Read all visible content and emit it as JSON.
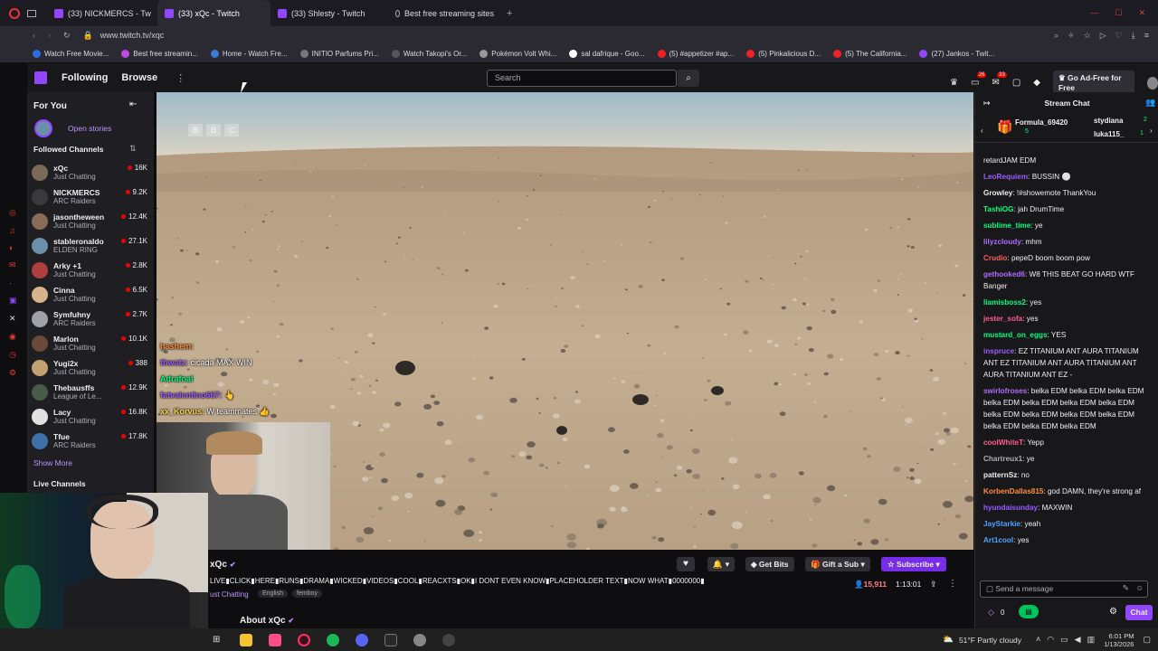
{
  "browser": {
    "tabs": [
      {
        "label": "(33) NICKMERCS - Tw"
      },
      {
        "label": "(33) xQc - Twitch"
      },
      {
        "label": "(33) Shlesty - Twitch"
      },
      {
        "label": "Best free streaming sites"
      }
    ],
    "url": "www.twitch.tv/xqc",
    "bookmarks": [
      "Watch Free Movie...",
      "Best free streamin...",
      "Home - Watch Fre...",
      "INITIO Parfums Pri...",
      "Watch Takopi's Or...",
      "Pokémon Volt Whi...",
      "sal dafrique - Goo...",
      "(5) #appetizer #ap...",
      "(5) Pinkalicious D...",
      "(5) The California...",
      "(27) Jankos - Twit..."
    ]
  },
  "nav": {
    "following": "Following",
    "browse": "Browse",
    "search_placeholder": "Search",
    "notif_badge": "26",
    "inbox_badge": "33",
    "ad_free": "Go Ad-Free for Free"
  },
  "sidebar": {
    "for_you": "For You",
    "open_stories": "Open stories",
    "followed": "Followed Channels",
    "channels": [
      {
        "name": "xQc",
        "game": "Just Chatting",
        "viewers": "16K",
        "color": "#7a6a58"
      },
      {
        "name": "NICKMERCS",
        "game": "ARC Raiders",
        "viewers": "9.2K",
        "color": "#3a3a3a"
      },
      {
        "name": "jasontheween",
        "game": "Just Chatting",
        "viewers": "12.4K",
        "color": "#8a6b55"
      },
      {
        "name": "stableronaldo",
        "game": "ELDEN RING",
        "viewers": "27.1K",
        "color": "#6b8fa8"
      },
      {
        "name": "Arky +1",
        "game": "Just Chatting",
        "viewers": "2.8K",
        "color": "#b04040"
      },
      {
        "name": "Cinna",
        "game": "Just Chatting",
        "viewers": "6.5K",
        "color": "#d6b38a"
      },
      {
        "name": "Symfuhny",
        "game": "ARC Raiders",
        "viewers": "2.7K",
        "color": "#a0a0a8"
      },
      {
        "name": "Marlon",
        "game": "Just Chatting",
        "viewers": "10.1K",
        "color": "#6a4a3a"
      },
      {
        "name": "Yugi2x",
        "game": "Just Chatting",
        "viewers": "388",
        "color": "#c2a070"
      },
      {
        "name": "Thebausffs",
        "game": "League of Le...",
        "viewers": "12.9K",
        "color": "#4a5a4a"
      },
      {
        "name": "Lacy",
        "game": "Just Chatting",
        "viewers": "16.8K",
        "color": "#e0e0e0"
      },
      {
        "name": "Tfue",
        "game": "ARC Raiders",
        "viewers": "17.8K",
        "color": "#3d6fa8"
      }
    ],
    "show_more": "Show More",
    "live_channels": "Live Channels"
  },
  "video": {
    "watermark": [
      "B",
      "B",
      "C"
    ],
    "overlay_chat": [
      {
        "user": "hashem:",
        "text": ""
      },
      {
        "user": "thwatz:",
        "text": " cicada  MAX WIN"
      },
      {
        "user": "Adrafoal",
        "text": ""
      },
      {
        "user": "fatvalentino667:",
        "text": " 👆"
      },
      {
        "user": "xx_Korvus:",
        "text": " W teammates 👍"
      }
    ]
  },
  "stream": {
    "streamer": "xQc",
    "title": "LIVE▮CLICK▮HERE▮RUNS▮DRAMA▮WICKED▮VIDEOS▮COOL▮REACXTS▮OK▮I DONT EVEN KNOW▮PLACEHOLDER TEXT▮NOW WHAT▮0000000▮",
    "category": "ust Chatting",
    "tags": [
      "English",
      "femboy"
    ],
    "viewers": "15,911",
    "uptime": "1:13:01",
    "get_bits": "Get Bits",
    "gift_sub": "Gift a Sub",
    "subscribe": "Subscribe",
    "about": "About xQc"
  },
  "chat": {
    "title": "Stream Chat",
    "gifters": [
      {
        "name": "Formula_69420",
        "count": "5"
      },
      {
        "name": "stydiana",
        "count": "2"
      },
      {
        "name": "luka115_",
        "count": "1"
      }
    ],
    "cut_line": "retardJAM EDM",
    "messages": [
      {
        "user": "LeoRequiem",
        "color": "#9a5cff",
        "text": ": BUSSIN ⚪"
      },
      {
        "user": "Growley",
        "color": "#efeff1",
        "text": ": !#showemote ThankYou"
      },
      {
        "user": "TashiOG",
        "color": "#00ff7f",
        "text": ": jah DrumTime"
      },
      {
        "user": "sublime_time",
        "color": "#00ff7f",
        "text": ": ye"
      },
      {
        "user": "lilyzcloudy",
        "color": "#b06cff",
        "text": ": mhm"
      },
      {
        "user": "Crudio",
        "color": "#ff5c5c",
        "text": ": pepeD boom boom pow"
      },
      {
        "user": "gethooked6",
        "color": "#b06cff",
        "text": ": W8 THIS BEAT GO HARD WTF Banger"
      },
      {
        "user": "liamisboss2",
        "color": "#00ff7f",
        "text": ": yes"
      },
      {
        "user": "jester_sofa",
        "color": "#ff5c8a",
        "text": ": yes"
      },
      {
        "user": "mustard_on_eggs",
        "color": "#00ff7f",
        "text": ": YES"
      },
      {
        "user": "inspruce",
        "color": "#9a5cff",
        "text": ": EZ TITANIUM ANT AURA TITANIUM ANT EZ TITANIUM ANT AURA TITANIUM ANT AURA TITANIUM ANT EZ -"
      },
      {
        "user": "swirlofroses",
        "color": "#b06cff",
        "text": ": belka EDM belka EDM belka EDM belka EDM belka EDM belka EDM belka EDM belka EDM belka EDM belka EDM belka EDM belka EDM belka EDM belka EDM"
      },
      {
        "user": "coolWhiteT",
        "color": "#ff5c8a",
        "text": ": Yepp"
      },
      {
        "user": "Chartreux1",
        "color": "#adadb8",
        "text": ": ye"
      },
      {
        "user": "patternSz",
        "color": "#efeff1",
        "text": ": no"
      },
      {
        "user": "KorbenDallas815",
        "color": "#ff8c3a",
        "text": ": god DAMN, they're strong af"
      },
      {
        "user": "hyundaisunday",
        "color": "#9a5cff",
        "text": ": MAXWIN"
      },
      {
        "user": "JayStarkie",
        "color": "#4fa3ff",
        "text": ": yeah"
      },
      {
        "user": "Art1cool",
        "color": "#4fa3ff",
        "text": ": yes"
      }
    ],
    "input_placeholder": "Send a message",
    "points": "0",
    "chat_button": "Chat"
  },
  "taskbar": {
    "weather": "51°F  Partly cloudy",
    "time": "6:01 PM",
    "date": "1/13/2026"
  },
  "colors": {
    "twitch": "#9146ff",
    "live": "#eb0400",
    "sub": "#772ce8"
  }
}
